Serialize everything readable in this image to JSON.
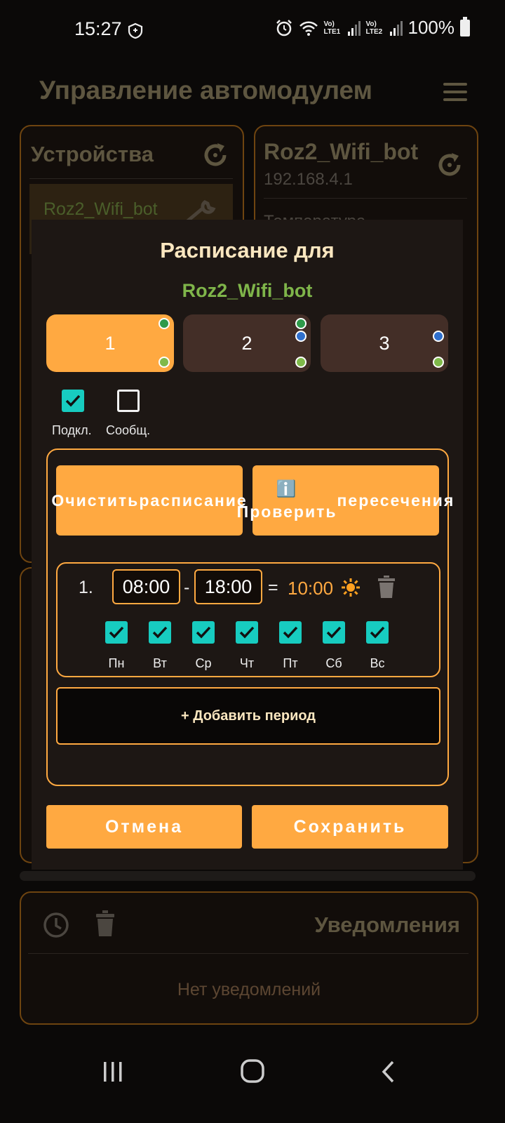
{
  "status_bar": {
    "time": "15:27",
    "lte1": "Vo) LTE1",
    "lte2": "Vo) LTE2",
    "battery_percent": "100%"
  },
  "app": {
    "title": "Управление автомодулем"
  },
  "devices_card": {
    "title": "Устройства",
    "items": [
      {
        "name": "Roz2_Wifi_bot"
      }
    ]
  },
  "device_card": {
    "name": "Roz2_Wifi_bot",
    "ip": "192.168.4.1",
    "field_label": "Температура"
  },
  "notifications": {
    "title": "Уведомления",
    "empty_text": "Нет уведомлений"
  },
  "modal": {
    "title": "Расписание для",
    "device_name": "Roz2_Wifi_bot",
    "slots": [
      {
        "label": "1",
        "active": true
      },
      {
        "label": "2",
        "active": false
      },
      {
        "label": "3",
        "active": false
      }
    ],
    "checkboxes": [
      {
        "label": "Подкл.",
        "checked": true
      },
      {
        "label": "Сообщ.",
        "checked": false
      }
    ],
    "clear_button": "Очистить расписание",
    "check_button": "ℹ️ Проверить пересечения",
    "periods": [
      {
        "number": "1.",
        "start": "08:00",
        "separator": "-",
        "end": "18:00",
        "equals": "=",
        "duration": "10:00",
        "days": [
          {
            "label": "Пн",
            "checked": true
          },
          {
            "label": "Вт",
            "checked": true
          },
          {
            "label": "Ср",
            "checked": true
          },
          {
            "label": "Чт",
            "checked": true
          },
          {
            "label": "Пт",
            "checked": true
          },
          {
            "label": "Сб",
            "checked": true
          },
          {
            "label": "Вс",
            "checked": true
          }
        ]
      }
    ],
    "add_period_button": "+ Добавить период",
    "cancel_button": "Отмена",
    "save_button": "Сохранить"
  },
  "colors": {
    "accent": "#ffa941",
    "checkbox": "#17ccc0",
    "device_green": "#7fb54a",
    "modal_bg": "#1d1714"
  }
}
